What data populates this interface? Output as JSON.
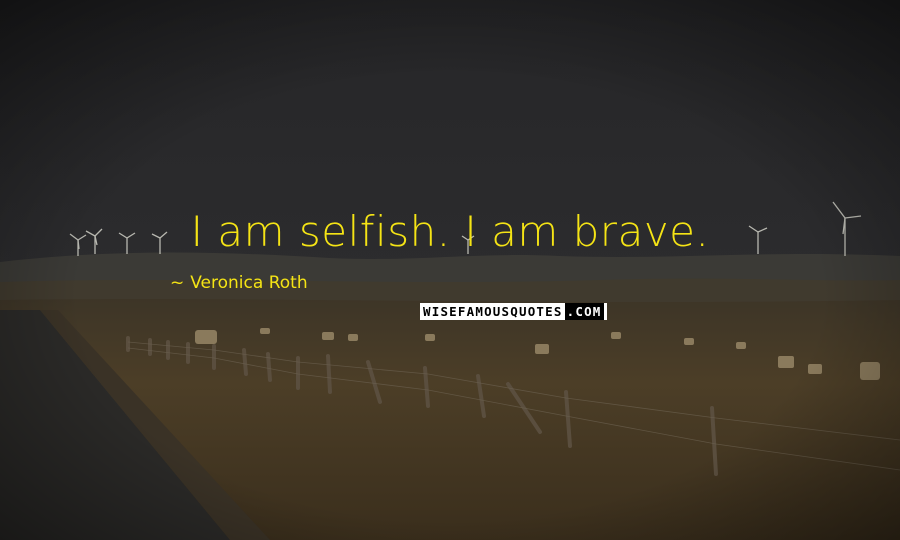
{
  "quote": {
    "text": "I am selfish. I am brave.",
    "author": "Veronica Roth",
    "author_prefix": "~"
  },
  "watermark": {
    "text": "WISEFAMOUSQUOTES",
    "suffix": ".COM"
  },
  "colors": {
    "text": "#f5e415",
    "sky": "#2a2a2c",
    "field": "#4a3d28"
  }
}
